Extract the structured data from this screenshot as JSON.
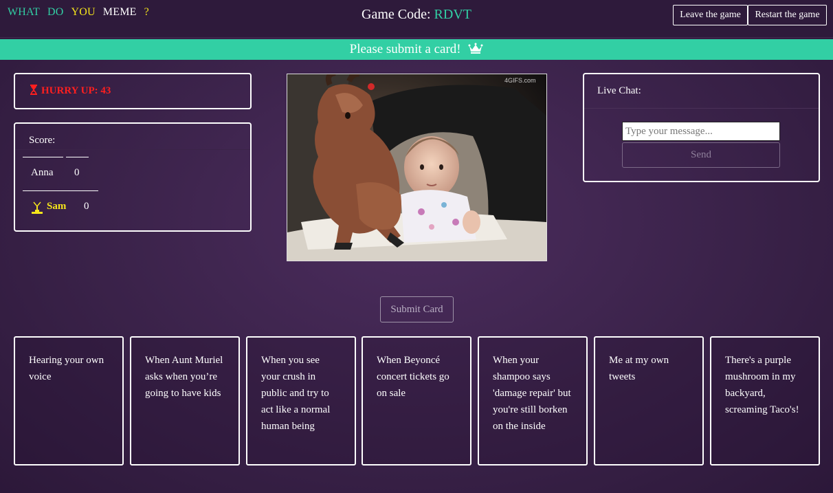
{
  "logo": {
    "words": [
      {
        "text": "WHAT",
        "color": "#32cfa4"
      },
      {
        "text": "DO",
        "color": "#32cfa4"
      },
      {
        "text": "YOU",
        "color": "#f5e51b"
      },
      {
        "text": "MEME",
        "color": "#ffffff"
      },
      {
        "text": "?",
        "color": "#f5e51b"
      }
    ]
  },
  "header": {
    "game_code_label": "Game Code:",
    "game_code": "RDVT",
    "leave_label": "Leave the game",
    "restart_label": "Restart the game"
  },
  "banner": {
    "text": "Please submit a card!",
    "icon": "crown-icon"
  },
  "timer": {
    "text": "HURRY UP: 43",
    "icon": "hourglass-icon"
  },
  "score": {
    "title": "Score:",
    "players": [
      {
        "name": "Anna",
        "points": "0",
        "judge": false
      },
      {
        "name": "Sam",
        "points": "0",
        "judge": true
      }
    ]
  },
  "gif": {
    "watermark": "4GIFS.com"
  },
  "chat": {
    "title": "Live Chat:",
    "placeholder": "Type your message...",
    "send_label": "Send"
  },
  "submit_label": "Submit Card",
  "cards": [
    "Hearing your own voice",
    "When Aunt Muriel asks when you’re going to have kids",
    "When you see your crush in public and try to act like a normal human being",
    "When Beyoncé concert tickets go on sale",
    "When your shampoo says 'damage repair' but you're still borken on the inside",
    "Me at my own tweets",
    "There's a purple mushroom in my backyard, screaming Taco's!"
  ],
  "colors": {
    "accent": "#32cfa4",
    "judge": "#f5e51b",
    "timer": "#ff1f1f"
  }
}
